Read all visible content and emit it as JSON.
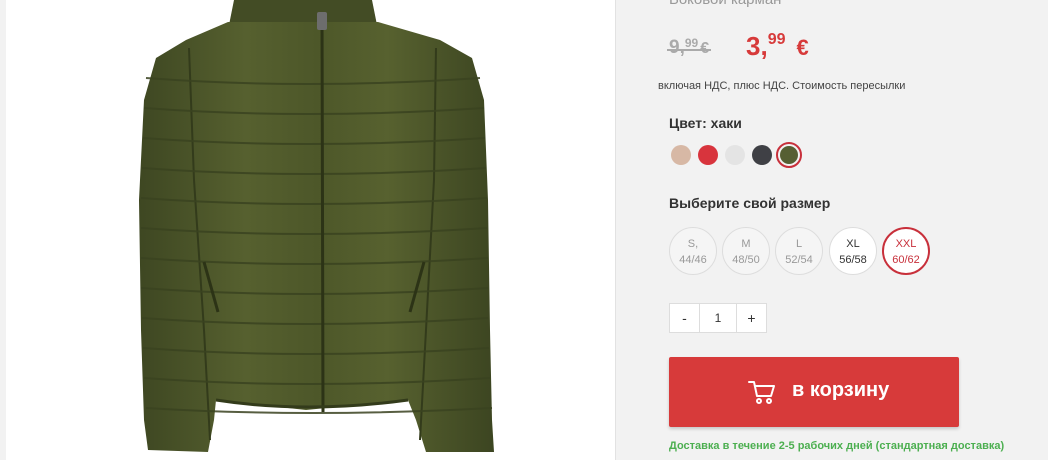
{
  "product": {
    "cut_title": "Боковой карман",
    "image_alt": "Куртка хаки"
  },
  "price": {
    "old_whole": "9,",
    "old_cents": "99",
    "old_currency": "€",
    "new_whole": "3,",
    "new_cents": "99",
    "new_currency": "€",
    "vat_note": "включая НДС, плюс НДС. Стоимость пересылки"
  },
  "color": {
    "label": "Цвет: хаки",
    "swatches": [
      {
        "name": "beige",
        "hex": "#d7b8a5",
        "selected": false
      },
      {
        "name": "red",
        "hex": "#d8343d",
        "selected": false
      },
      {
        "name": "light-grey",
        "hex": "#e4e4e4",
        "selected": false
      },
      {
        "name": "dark-grey",
        "hex": "#3f4045",
        "selected": false
      },
      {
        "name": "khaki",
        "hex": "#565f33",
        "selected": true
      }
    ]
  },
  "sizes": {
    "label": "Выберите свой размер",
    "options": [
      {
        "size": "S,",
        "numeric": "44/46",
        "state": "unavailable"
      },
      {
        "size": "M",
        "numeric": "48/50",
        "state": "unavailable"
      },
      {
        "size": "L",
        "numeric": "52/54",
        "state": "unavailable"
      },
      {
        "size": "XL",
        "numeric": "56/58",
        "state": "available"
      },
      {
        "size": "XXL",
        "numeric": "60/62",
        "state": "selected"
      }
    ]
  },
  "quantity": {
    "minus": "-",
    "value": "1",
    "plus": "+"
  },
  "cart": {
    "label": "в корзину",
    "icon": "shopping-cart-icon"
  },
  "delivery": {
    "text": "Доставка в течение 2-5 рабочих дней (стандартная доставка)"
  },
  "colors": {
    "accent": "#d73a3a",
    "selected_border": "#c8303b",
    "delivery_green": "#4caf50",
    "jacket": "#4f5a2c"
  }
}
